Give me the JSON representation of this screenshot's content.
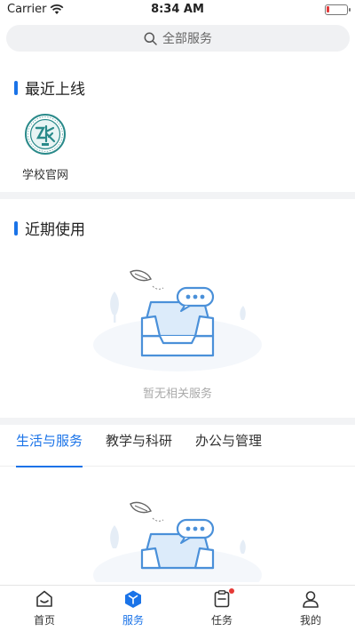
{
  "status_bar": {
    "carrier": "Carrier",
    "time": "8:34 AM"
  },
  "search": {
    "placeholder": "全部服务"
  },
  "recent": {
    "title": "最近上线",
    "apps": [
      {
        "label": "学校官网",
        "icon": "school-logo-icon"
      }
    ]
  },
  "recent_use": {
    "title": "近期使用",
    "empty_text": "暂无相关服务"
  },
  "tabs": [
    {
      "label": "生活与服务",
      "active": true
    },
    {
      "label": "教学与科研",
      "active": false
    },
    {
      "label": "办公与管理",
      "active": false
    }
  ],
  "bottom_nav": [
    {
      "label": "首页",
      "icon": "home-icon",
      "active": false
    },
    {
      "label": "服务",
      "icon": "service-cube-icon",
      "active": true
    },
    {
      "label": "任务",
      "icon": "task-clipboard-icon",
      "active": false,
      "badge": true
    },
    {
      "label": "我的",
      "icon": "profile-icon",
      "active": false
    }
  ],
  "colors": {
    "accent": "#1a73e8",
    "badge": "#e53935",
    "divider": "#f2f3f5"
  }
}
